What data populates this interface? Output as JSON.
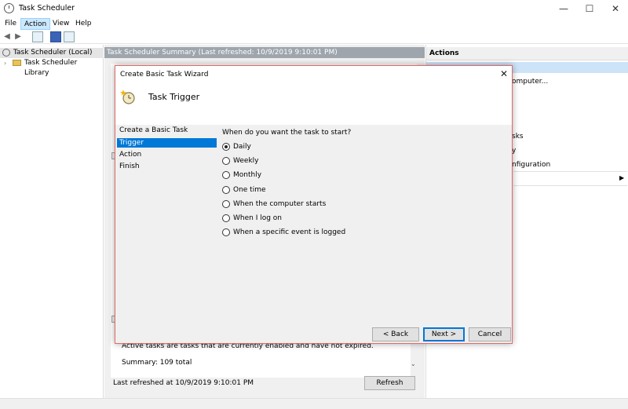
{
  "window": {
    "title": "Task Scheduler",
    "minimize": "—",
    "maximize": "☐",
    "close": "✕"
  },
  "menu": [
    "File",
    "Action",
    "View",
    "Help"
  ],
  "tree": {
    "items": [
      {
        "label": "Task Scheduler (Local)"
      },
      {
        "label": "Task Scheduler Library"
      }
    ]
  },
  "center": {
    "header": "Task Scheduler Summary (Last refreshed: 10/9/2019 9:10:01 PM)",
    "active_text": "Active tasks are tasks that are currently enabled and have not expired.",
    "summary": "Summary: 109 total",
    "last_refreshed": "Last refreshed at 10/9/2019 9:10:01 PM",
    "refresh_label": "Refresh"
  },
  "actions": {
    "header": "Actions",
    "items": [
      "omputer...",
      "sks",
      "y",
      "nfiguration"
    ]
  },
  "dialog": {
    "title": "Create Basic Task Wizard",
    "heading": "Task Trigger",
    "close": "✕",
    "steps": [
      "Create a Basic Task",
      "Trigger",
      "Action",
      "Finish"
    ],
    "selected_step": 1,
    "question": "When do you want the task to start?",
    "options": [
      "Daily",
      "Weekly",
      "Monthly",
      "One time",
      "When the computer starts",
      "When I log on",
      "When a specific event is logged"
    ],
    "selected_option": 0,
    "buttons": {
      "back": "< Back",
      "next": "Next >",
      "cancel": "Cancel"
    }
  }
}
